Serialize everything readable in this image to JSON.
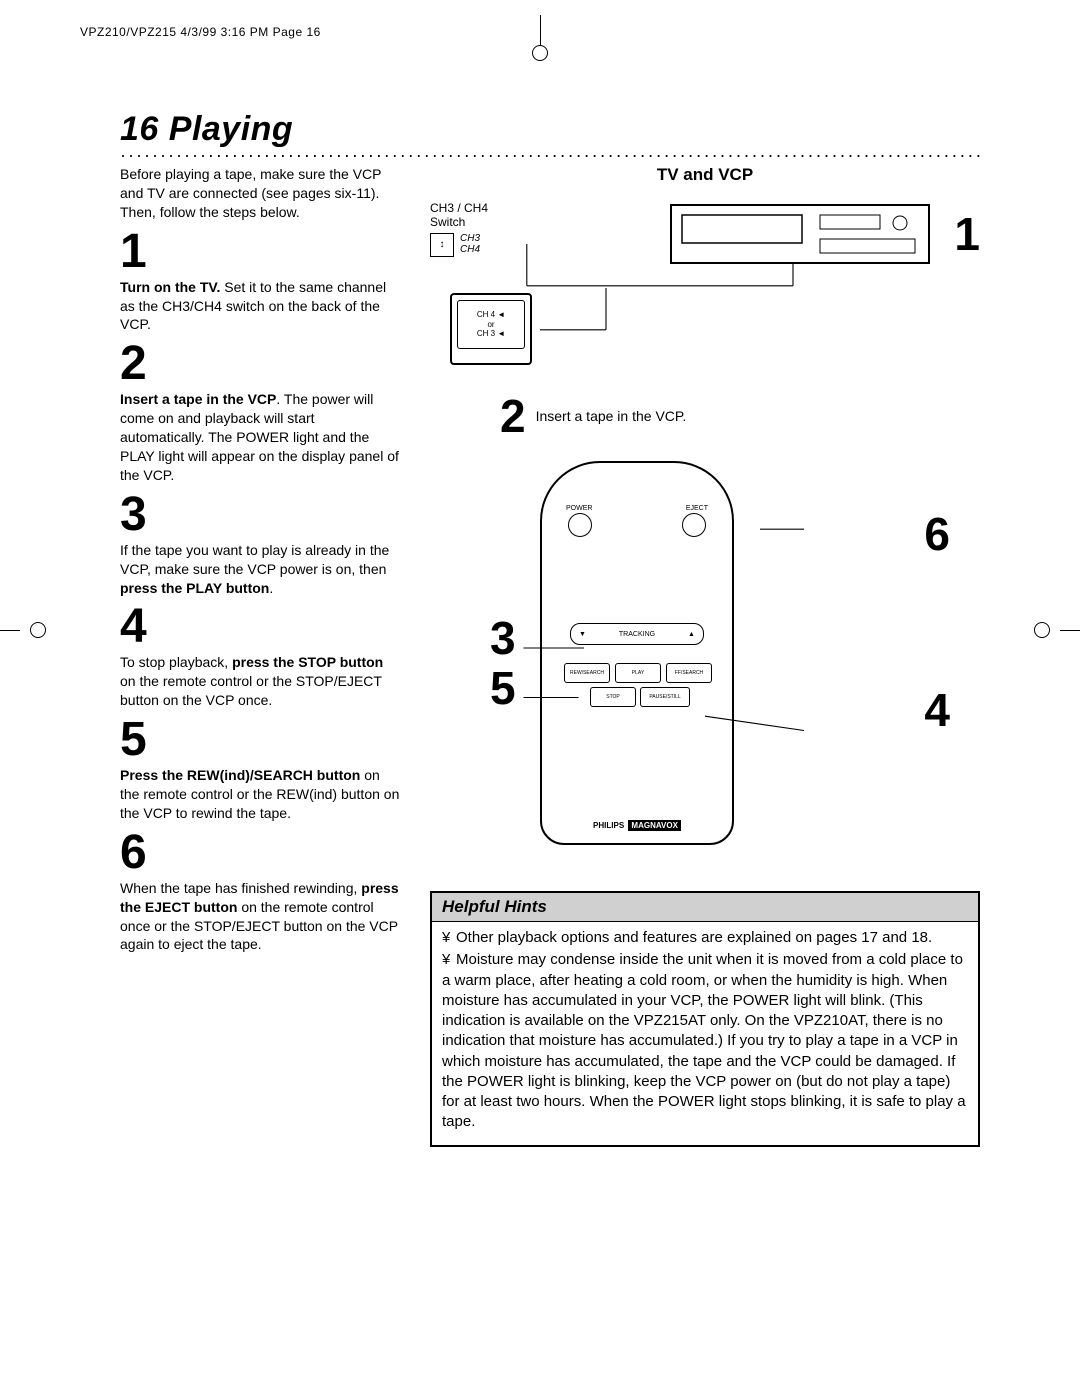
{
  "header": "VPZ210/VPZ215  4/3/99  3:16 PM  Page 16",
  "title": "16  Playing",
  "left": {
    "intro": "Before playing a tape, make sure the VCP and TV are connected (see pages six-11). Then, follow the steps below.",
    "steps": [
      {
        "n": "1",
        "bold": "Turn on the TV.",
        "rest": " Set it to the same channel as the CH3/CH4 switch on the back of the VCP."
      },
      {
        "n": "2",
        "bold": "Insert a tape in the VCP",
        "rest": ". The power will come on and playback will start automatically. The POWER light and the PLAY light will appear on the display panel of the VCP."
      },
      {
        "n": "3",
        "pre": "If the tape you want to play is already in the VCP, make sure the VCP power is on, then ",
        "bold": "press the PLAY button",
        "post": "."
      },
      {
        "n": "4",
        "pre": "To stop playback, ",
        "bold": "press the STOP button",
        "post": " on the remote control or the STOP/EJECT button on the VCP once."
      },
      {
        "n": "5",
        "bold": "Press the REW(ind)/SEARCH button",
        "post": " on the remote control or the REW(ind) button on the VCP to rewind the tape."
      },
      {
        "n": "6",
        "pre": "When the tape has finished rewinding, ",
        "bold": "press the EJECT button",
        "post": " on the remote control once or the STOP/EJECT button on the VCP again to eject the tape."
      }
    ]
  },
  "right": {
    "tv_vcp_title": "TV and VCP",
    "switch_label_1": "CH3 / CH4",
    "switch_label_2": "Switch",
    "switch_ch3": "CH3",
    "switch_ch4": "CH4",
    "tv_ch4": "CH 4 ◄",
    "tv_or": "or",
    "tv_ch3": "CH 3 ◄",
    "callouts": {
      "one": "1",
      "two": "2",
      "three": "3",
      "four": "4",
      "five": "5",
      "six": "6"
    },
    "step2_text": "Insert a tape in the VCP.",
    "remote": {
      "power": "POWER",
      "eject": "EJECT",
      "tracking": "TRACKING",
      "rew": "REW/SEARCH",
      "play": "PLAY",
      "ff": "FF/SEARCH",
      "stop": "STOP",
      "pause": "PAUSE/STILL",
      "brand1": "PHILIPS",
      "brand2": "MAGNAVOX"
    }
  },
  "hints": {
    "title": "Helpful Hints",
    "items": [
      "Other playback options and features are explained on pages 17 and 18.",
      "Moisture may condense inside the unit when it is moved from a cold place to a warm place, after heating a cold room, or when the humidity is high. When moisture has accumulated in your VCP, the POWER light will blink. (This indication is available on the VPZ215AT only. On the VPZ210AT, there is no indication that moisture has accumulated.)  If you try to play a tape in a VCP in which moisture has accumulated, the tape and the VCP could be damaged. If the POWER light is blinking, keep the VCP power on (but do not play a tape) for at least two hours. When the POWER light stops blinking, it is safe to play a tape."
    ]
  }
}
